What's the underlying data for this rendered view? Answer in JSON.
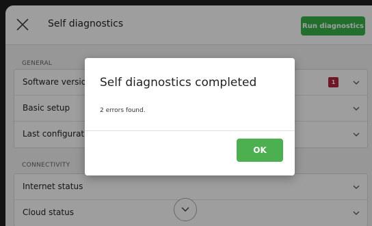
{
  "header": {
    "title": "Self diagnostics",
    "run_button": "Run diagnostics"
  },
  "sections": {
    "general_label": "GENERAL",
    "connectivity_label": "CONNECTIVITY"
  },
  "general_items": [
    {
      "label": "Software version",
      "badge": "1"
    },
    {
      "label": "Basic setup"
    },
    {
      "label": "Last configuration"
    }
  ],
  "connectivity_items": [
    {
      "label": "Internet status"
    },
    {
      "label": "Cloud status"
    }
  ],
  "dialog": {
    "title": "Self diagnostics completed",
    "message": "2 errors found.",
    "ok_label": "OK"
  },
  "colors": {
    "accent_green": "#38b44a",
    "badge_red": "#b3263f"
  }
}
